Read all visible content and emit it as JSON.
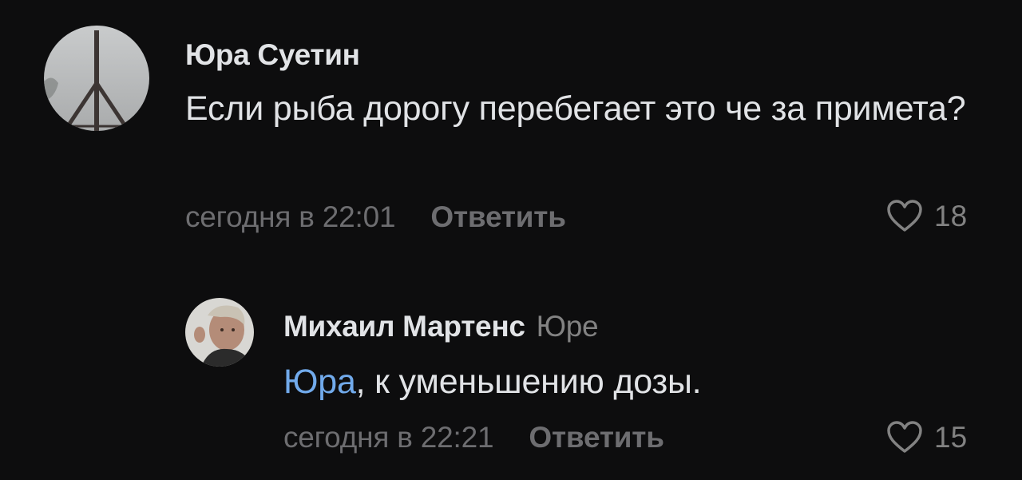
{
  "comment": {
    "author": "Юра Суетин",
    "text": "Если рыба дорогу перебегает это че за примета?",
    "time": "сегодня в 22:01",
    "reply_label": "Ответить",
    "likes": "18",
    "avatar_icon": "peace-sign-icon"
  },
  "reply": {
    "author": "Михаил Мартенс",
    "addressee": "Юре",
    "mention": "Юра",
    "text": ", к уменьшению дозы.",
    "time": "сегодня в 22:21",
    "reply_label": "Ответить",
    "likes": "15"
  },
  "colors": {
    "background": "#0d0d0e",
    "text": "#e1e3e6",
    "secondary": "#6d6d70",
    "mention": "#71aaeb"
  }
}
